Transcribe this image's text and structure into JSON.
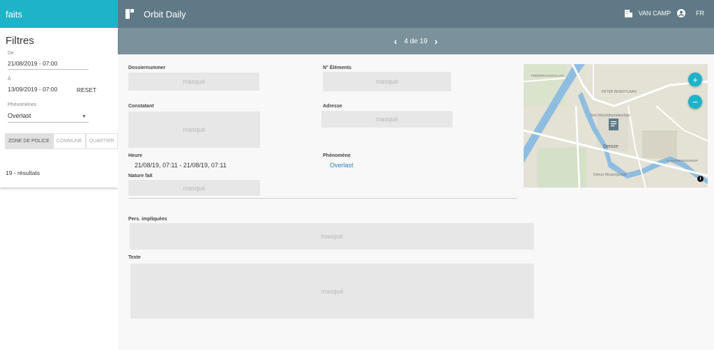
{
  "sidebar": {
    "header": "faits",
    "filters_title": "Filtres",
    "from_label": "De",
    "from_value": "21/08/2019 - 07:00",
    "to_label": "À",
    "to_value": "13/09/2019 - 07:00",
    "reset_label": "RESET",
    "phenomenes_label": "Phénomènes",
    "phenomenes_value": "Overlast",
    "segments": [
      "ZONE DE POLICE",
      "COMMUNE",
      "QUARTIER"
    ],
    "results": "19 - résultats"
  },
  "topbar": {
    "title": "Orbit Daily",
    "user": "VAN CAMP",
    "lang": "FR"
  },
  "pager": {
    "text": "4 de 19"
  },
  "detail": {
    "dossier_label": "Dossiernummer",
    "dossier_value": "masqué",
    "elements_label": "N° Éléments",
    "elements_value": "masqué",
    "constatant_label": "Constatant",
    "constatant_value": "masqué",
    "adresse_label": "Adresse",
    "adresse_value": "masqué",
    "heure_label": "Heure",
    "heure_value": "21/08/19, 07:11 - 21/08/19, 07:11",
    "phenomene_label": "Phénomène",
    "phenomene_value": "Overlast",
    "nature_label": "Nature fait",
    "nature_value": "masqué",
    "pers_label": "Pers. impliquées",
    "pers_value": "masqué",
    "texte_label": "Texte",
    "texte_value": "masqué"
  },
  "map": {
    "streets": [
      "PETER BENOITLAAN",
      "Sint-Vincentiusziekenhuis",
      "Deinze",
      "Deinze Mouterijstraat",
      "DOOMMEERSDREEF",
      "TWEEBRUGGENLAAN"
    ],
    "zoom_in": "+",
    "zoom_out": "−",
    "info": "i"
  },
  "colors": {
    "accent": "#1eb3c8",
    "topbar": "#5f7986",
    "subbar": "#7b929d"
  }
}
